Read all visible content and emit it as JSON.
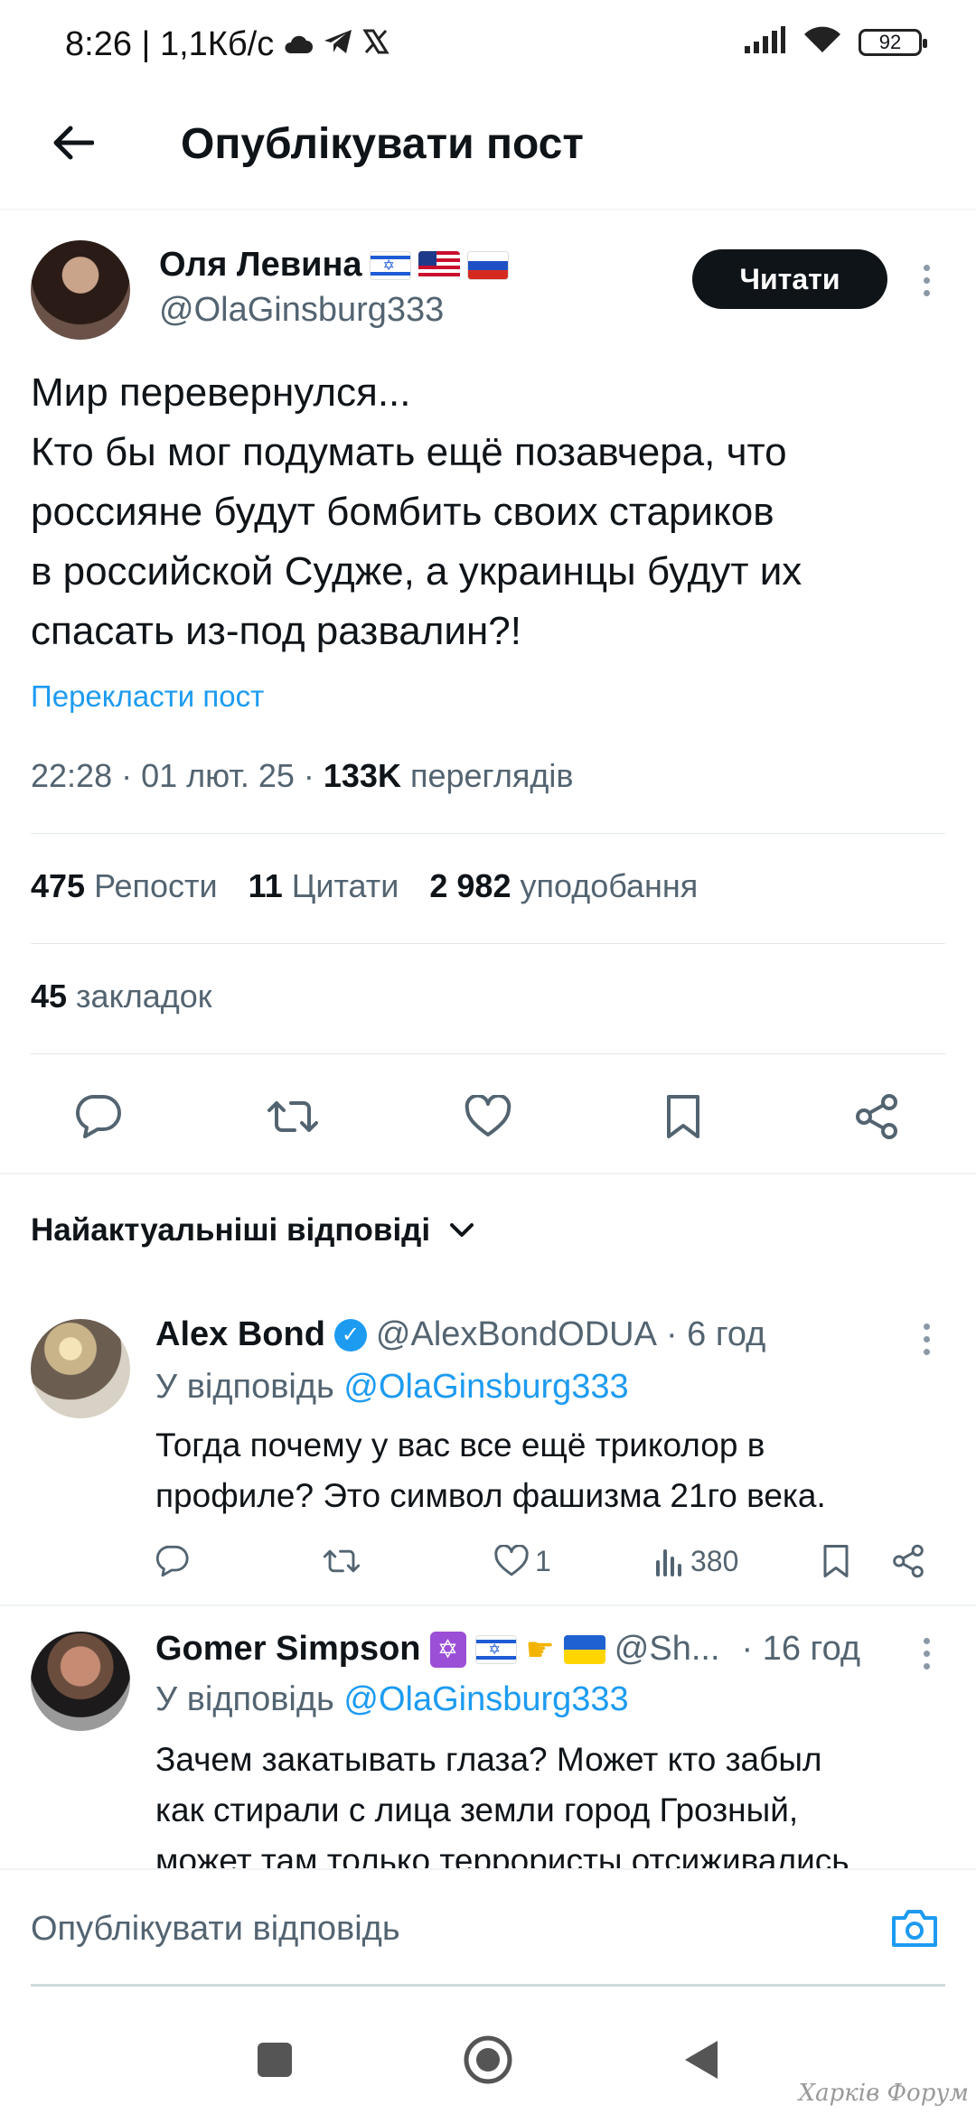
{
  "status_bar": {
    "time_and_speed": "8:26 | 1,1Кб/с",
    "battery": "92"
  },
  "header": {
    "title": "Опублікувати пост"
  },
  "post": {
    "author_name": "Оля Левина",
    "author_handle": "@OlaGinsburg333",
    "read_label": "Читати",
    "text_lines": [
      "Мир перевернулся...",
      "Кто бы мог подумать ещё позавчера, что",
      "россияне будут бомбить своих стариков",
      "в российской Судже, а украинцы будут их",
      "спасать из-под развалин?!"
    ],
    "translate_label": "Перекласти пост",
    "timestamp": "22:28 · 01 лют. 25 · ",
    "views_count": "133K",
    "views_label": "переглядів",
    "reposts_count": "475",
    "reposts_label": "Репости",
    "quotes_count": "11",
    "quotes_label": "Цитати",
    "likes_count": "2 982",
    "likes_label": "уподобання",
    "bookmarks_count": "45",
    "bookmarks_label": "закладок"
  },
  "replies_sort_label": "Найактуальніші відповіді",
  "replies": [
    {
      "name": "Alex Bond",
      "handle": "@AlexBondODUA",
      "time": "· 6 год",
      "reply_to_prefix": "У відповідь",
      "reply_to_handle": "@OlaGinsburg333",
      "text_lines": [
        "Тогда почему у вас все ещё триколор в",
        "профиле? Это символ фашизма 21го века."
      ],
      "likes": "1",
      "views": "380"
    },
    {
      "name": "Gomer Simpson",
      "handle": "@Sh...",
      "time": "· 16 год",
      "reply_to_prefix": "У відповідь",
      "reply_to_handle": "@OlaGinsburg333",
      "text_lines": [
        "Зачем закатывать глаза? Может кто забыл",
        "как стирали с лица земли город Грозный,",
        "может там только террористы отсиживались"
      ]
    }
  ],
  "composer": {
    "placeholder": "Опублікувати відповідь"
  },
  "watermark": "Харків Форум",
  "colors": {
    "accent": "#1d9bf0",
    "text_primary": "#0f1419",
    "text_secondary": "#536471"
  }
}
